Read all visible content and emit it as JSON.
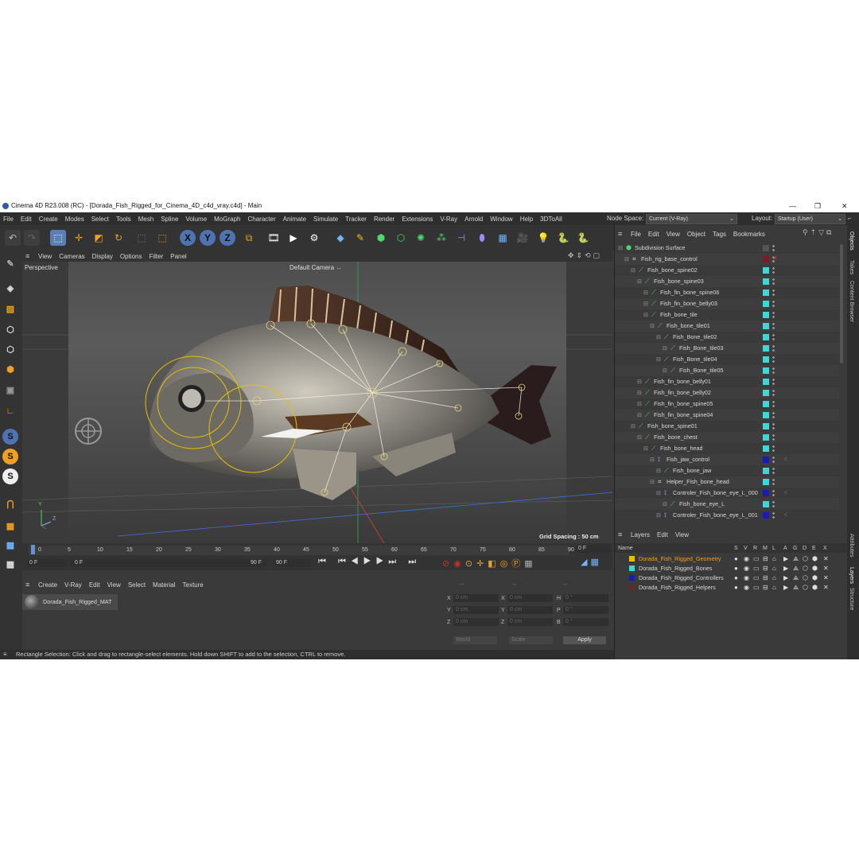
{
  "window": {
    "title": "Cinema 4D R23.008 (RC) - [Dorada_Fish_Rigged_for_Cinema_4D_c4d_vray.c4d] - Main"
  },
  "menu": [
    "File",
    "Edit",
    "Create",
    "Modes",
    "Select",
    "Tools",
    "Mesh",
    "Spline",
    "Volume",
    "MoGraph",
    "Character",
    "Animate",
    "Simulate",
    "Tracker",
    "Render",
    "Extensions",
    "V-Ray",
    "Arnold",
    "Window",
    "Help",
    "3DToAll"
  ],
  "node_space": {
    "label": "Node Space:",
    "value": "Current (V-Ray)"
  },
  "layout": {
    "label": "Layout:",
    "value": "Startup (User)"
  },
  "viewport": {
    "menu": [
      "View",
      "Cameras",
      "Display",
      "Options",
      "Filter",
      "Panel"
    ],
    "name": "Perspective",
    "camera": "Default Camera",
    "grid_spacing": "Grid Spacing : 50 cm",
    "axis_y": "Y",
    "axis_z": "Z"
  },
  "timeline": {
    "ticks": [
      "0",
      "5",
      "10",
      "15",
      "20",
      "25",
      "30",
      "35",
      "40",
      "45",
      "50",
      "55",
      "60",
      "65",
      "70",
      "75",
      "80",
      "85",
      "90"
    ],
    "current_frame": "0 F",
    "start": "0 F",
    "range_start": "0 F",
    "range_end": "90 F",
    "end": "90 F"
  },
  "material_manager": {
    "menu": [
      "Create",
      "V-Ray",
      "Edit",
      "View",
      "Select",
      "Material",
      "Texture"
    ],
    "material_name": "Dorada_Fish_Rigged_MAT"
  },
  "coords": {
    "header": [
      "--",
      "--",
      "--"
    ],
    "rows": [
      {
        "a": "X",
        "av": "0 cm",
        "b": "X",
        "bv": "0 cm",
        "c": "H",
        "cv": "0 °"
      },
      {
        "a": "Y",
        "av": "0 cm",
        "b": "Y",
        "bv": "0 cm",
        "c": "P",
        "cv": "0 °"
      },
      {
        "a": "Z",
        "av": "0 cm",
        "b": "Z",
        "bv": "0 cm",
        "c": "B",
        "cv": "0 °"
      }
    ],
    "world": "World",
    "scale": "Scale",
    "apply": "Apply"
  },
  "status": "Rectangle Selection: Click and drag to rectangle-select elements. Hold down SHIFT to add to the selection, CTRL to remove.",
  "objects": {
    "menu": [
      "File",
      "Edit",
      "View",
      "Object",
      "Tags",
      "Bookmarks"
    ],
    "items": [
      {
        "name": "Subdivision Surface",
        "indent": 0,
        "color": "",
        "icon": "subdiv"
      },
      {
        "name": "Fish_rig_base_control",
        "indent": 1,
        "color": "#7a1d2a",
        "icon": "null"
      },
      {
        "name": "Fish_bone_spine02",
        "indent": 2,
        "color": "#3fd6d6",
        "icon": "bone"
      },
      {
        "name": "Fish_bone_spine03",
        "indent": 3,
        "color": "#3fd6d6",
        "icon": "bone"
      },
      {
        "name": "Fish_fin_bone_spine06",
        "indent": 4,
        "color": "#3fd6d6",
        "icon": "bone"
      },
      {
        "name": "Fish_fin_bone_belly03",
        "indent": 4,
        "color": "#3fd6d6",
        "icon": "bone"
      },
      {
        "name": "Fish_bone_tile",
        "indent": 4,
        "color": "#3fd6d6",
        "icon": "bone"
      },
      {
        "name": "Fish_bone_tile01",
        "indent": 5,
        "color": "#3fd6d6",
        "icon": "bone"
      },
      {
        "name": "Fish_Bone_tile02",
        "indent": 6,
        "color": "#3fd6d6",
        "icon": "bone"
      },
      {
        "name": "Fish_Bone_tile03",
        "indent": 7,
        "color": "#3fd6d6",
        "icon": "bone"
      },
      {
        "name": "Fish_Bone_tile04",
        "indent": 6,
        "color": "#3fd6d6",
        "icon": "bone"
      },
      {
        "name": "Fish_Bone_tile05",
        "indent": 7,
        "color": "#3fd6d6",
        "icon": "bone"
      },
      {
        "name": "Fish_fin_bone_belly01",
        "indent": 3,
        "color": "#3fd6d6",
        "icon": "bone"
      },
      {
        "name": "Fish_fin_bone_belly02",
        "indent": 3,
        "color": "#3fd6d6",
        "icon": "bone"
      },
      {
        "name": "Fish_fin_bone_spine05",
        "indent": 3,
        "color": "#3fd6d6",
        "icon": "bone"
      },
      {
        "name": "Fish_fin_bone_spine04",
        "indent": 3,
        "color": "#3fd6d6",
        "icon": "bone"
      },
      {
        "name": "Fish_bone_spine01",
        "indent": 2,
        "color": "#3fd6d6",
        "icon": "bone"
      },
      {
        "name": "Fish_bone_chest",
        "indent": 3,
        "color": "#3fd6d6",
        "icon": "bone"
      },
      {
        "name": "Fish_bone_head",
        "indent": 4,
        "color": "#3fd6d6",
        "icon": "bone"
      },
      {
        "name": "Fish_jaw_control",
        "indent": 5,
        "color": "#1a1ab8",
        "icon": "joint"
      },
      {
        "name": "Fish_bone_jaw",
        "indent": 6,
        "color": "#3fd6d6",
        "icon": "bone"
      },
      {
        "name": "Helper_Fish_bone_head",
        "indent": 5,
        "color": "#3fd6d6",
        "icon": "null"
      },
      {
        "name": "Controler_Fish_bone_eye_L_000",
        "indent": 6,
        "color": "#1a1ab8",
        "icon": "joint"
      },
      {
        "name": "Fish_bone_eye_L",
        "indent": 7,
        "color": "#3fd6d6",
        "icon": "bone"
      },
      {
        "name": "Controler_Fish_bone_eye_L_001",
        "indent": 6,
        "color": "#1a1ab8",
        "icon": "joint"
      }
    ]
  },
  "layers": {
    "menu": [
      "Layers",
      "Edit",
      "View"
    ],
    "columns": [
      "Name",
      "S",
      "V",
      "R",
      "M",
      "L",
      "A",
      "G",
      "D",
      "E",
      "X"
    ],
    "items": [
      {
        "name": "Dorada_Fish_Rigged_Geometry",
        "color": "#e8c000",
        "active": true
      },
      {
        "name": "Dorada_Fish_Rigged_Bones",
        "color": "#3fd6d6",
        "active": false
      },
      {
        "name": "Dorada_Fish_Rigged_Controllers",
        "color": "#1a1ab8",
        "active": false
      },
      {
        "name": "Dorada_Fish_Rigged_Helpers",
        "color": "#7a1d2a",
        "active": false
      }
    ]
  },
  "right_tabs": [
    "Objects",
    "Takes",
    "Content Browser",
    "Attributes",
    "Layers",
    "Structure"
  ]
}
